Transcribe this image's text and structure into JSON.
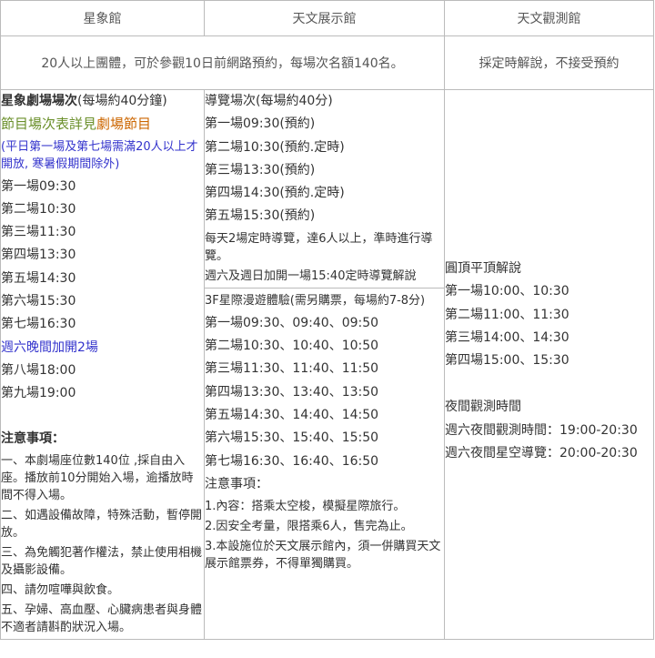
{
  "header": [
    "星象館",
    "天文展示館",
    "天文觀測館"
  ],
  "info": {
    "left": "20人以上團體，可於參觀10日前網路預約，每場次名額140名。",
    "right": "採定時解說，不接受預約"
  },
  "planetarium": {
    "title": "星象劇場場次",
    "duration": "(每場約40分鐘)",
    "schedule_prefix": "節目場次表詳見",
    "schedule_link": "劇場節目",
    "note": "(平日第一場及第七場需滿20人以上才開放, 寒暑假期間除外)",
    "sessions": [
      "第一場09:30",
      "第二場10:30",
      "第三場11:30",
      "第四場13:30",
      "第五場14:30",
      "第六場15:30",
      "第七場16:30"
    ],
    "saturday_extra": "週六晚間加開2場",
    "evening_sessions": [
      "第八場18:00",
      "第九場19:00"
    ],
    "notice_title": "注意事項：",
    "notices": [
      "一、本劇場座位數140位 ,採自由入座。播放前10分開始入場，逾播放時間不得入場。",
      "二、如遇設備故障，特殊活動，暫停開放。",
      "三、為免觸犯著作權法，禁止使用相機及攝影設備。",
      "四、請勿喧嘩與飲食。",
      "五、孕婦、高血壓、心臟病患者與身體不適者請斟酌狀況入場。"
    ]
  },
  "exhibition": {
    "tour_title": "導覽場次",
    "tour_duration": "(每場約40分)",
    "tours": [
      "第一場09:30(預約)",
      "第二場10:30(預約.定時)",
      "第三場13:30(預約)",
      "第四場14:30(預約.定時)",
      "第五場15:30(預約)"
    ],
    "tour_note1": "每天2場定時導覽，達6人以上，準時進行導覽。",
    "tour_note2": "週六及週日加開一場15:40定時導覽解說",
    "ride_title": "3F星際漫遊體驗(需另購票，每場約7-8分)",
    "rides": [
      "第一場09:30、09:40、09:50",
      "第二場10:30、10:40、10:50",
      "第三場11:30、11:40、11:50",
      "第四場13:30、13:40、13:50",
      "第五場14:30、14:40、14:50",
      "第六場15:30、15:40、15:50",
      "第七場16:30、16:40、16:50"
    ],
    "notice_title": "注意事項：",
    "notices": [
      "1.內容：搭乘太空梭，模擬星際旅行。",
      "2.因安全考量，限搭乘6人，售完為止。",
      "3.本設施位於天文展示館內，須一併購買天文展示館票券，不得單獨購買。"
    ]
  },
  "observatory": {
    "dome_title": "圓頂平頂解說",
    "dome_sessions": [
      "第一場10:00、10:30",
      "第二場11:00、11:30",
      "第三場14:00、14:30",
      "第四場15:00、15:30"
    ],
    "night_title": "夜間觀測時間",
    "night_items": [
      "週六夜間觀測時間：19:00-20:30",
      "週六夜間星空導覽：20:00-20:30"
    ]
  }
}
